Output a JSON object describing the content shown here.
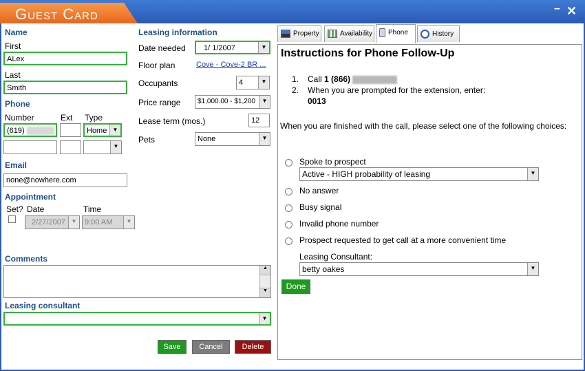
{
  "window": {
    "title": "Guest Card",
    "minimize": "–",
    "close": "✕"
  },
  "left": {
    "name_section": "Name",
    "first_label": "First",
    "first_value": "ALex",
    "last_label": "Last",
    "last_value": "Smith",
    "phone_section": "Phone",
    "number_label": "Number",
    "ext_label": "Ext",
    "type_label": "Type",
    "phone1_prefix": "(619)",
    "phone1_type": "Home",
    "email_section": "Email",
    "email_value": "none@nowhere.com",
    "appointment_section": "Appointment",
    "set_label": "Set?",
    "date_label": "Date",
    "time_label": "Time",
    "appt_date": "2/27/2007",
    "appt_time": "9:00 AM",
    "comments_section": "Comments",
    "consultant_section": "Leasing consultant",
    "consultant_value": ""
  },
  "leasing": {
    "section": "Leasing information",
    "date_needed_label": "Date needed",
    "date_needed_value": "1/  1/2007",
    "floor_plan_label": "Floor plan",
    "floor_plan_value": "Cove - Cove-2 BR ...",
    "occupants_label": "Occupants",
    "occupants_value": "4",
    "price_label": "Price range",
    "price_value": "$1,000.00 - $1,200",
    "lease_term_label": "Lease term (mos.)",
    "lease_term_value": "12",
    "pets_label": "Pets",
    "pets_value": "None"
  },
  "buttons": {
    "save": "Save",
    "cancel": "Cancel",
    "delete": "Delete"
  },
  "colors": {
    "save": "#1e9a1e",
    "cancel": "#7d7d7d",
    "delete": "#9b1010",
    "accent": "#2a5ab4",
    "title_tab": "#e8661d"
  },
  "tabs": [
    {
      "label": "Property",
      "icon": "property-icon"
    },
    {
      "label": "Availability",
      "icon": "availability-icon"
    },
    {
      "label": "Phone",
      "icon": "phone-icon"
    },
    {
      "label": "History",
      "icon": "history-icon"
    }
  ],
  "phone_panel": {
    "heading": "Instructions for Phone Follow-Up",
    "step1_num": "1.",
    "step1_text": "Call ",
    "step1_bold": "1 (866)",
    "step2_num": "2.",
    "step2_text": "When you are prompted for the extension, enter:",
    "extension": "0013",
    "instruction": "When you are finished with the call, please select one of the following choices:",
    "options": [
      "Spoke to prospect",
      "No answer",
      "Busy signal",
      "Invalid phone number",
      "Prospect requested to get call at a more convenient time"
    ],
    "spoke_select": "Active - HIGH probability of leasing",
    "consultant_label": "Leasing Consultant:",
    "consultant_value": "betty oakes",
    "done": "Done"
  }
}
